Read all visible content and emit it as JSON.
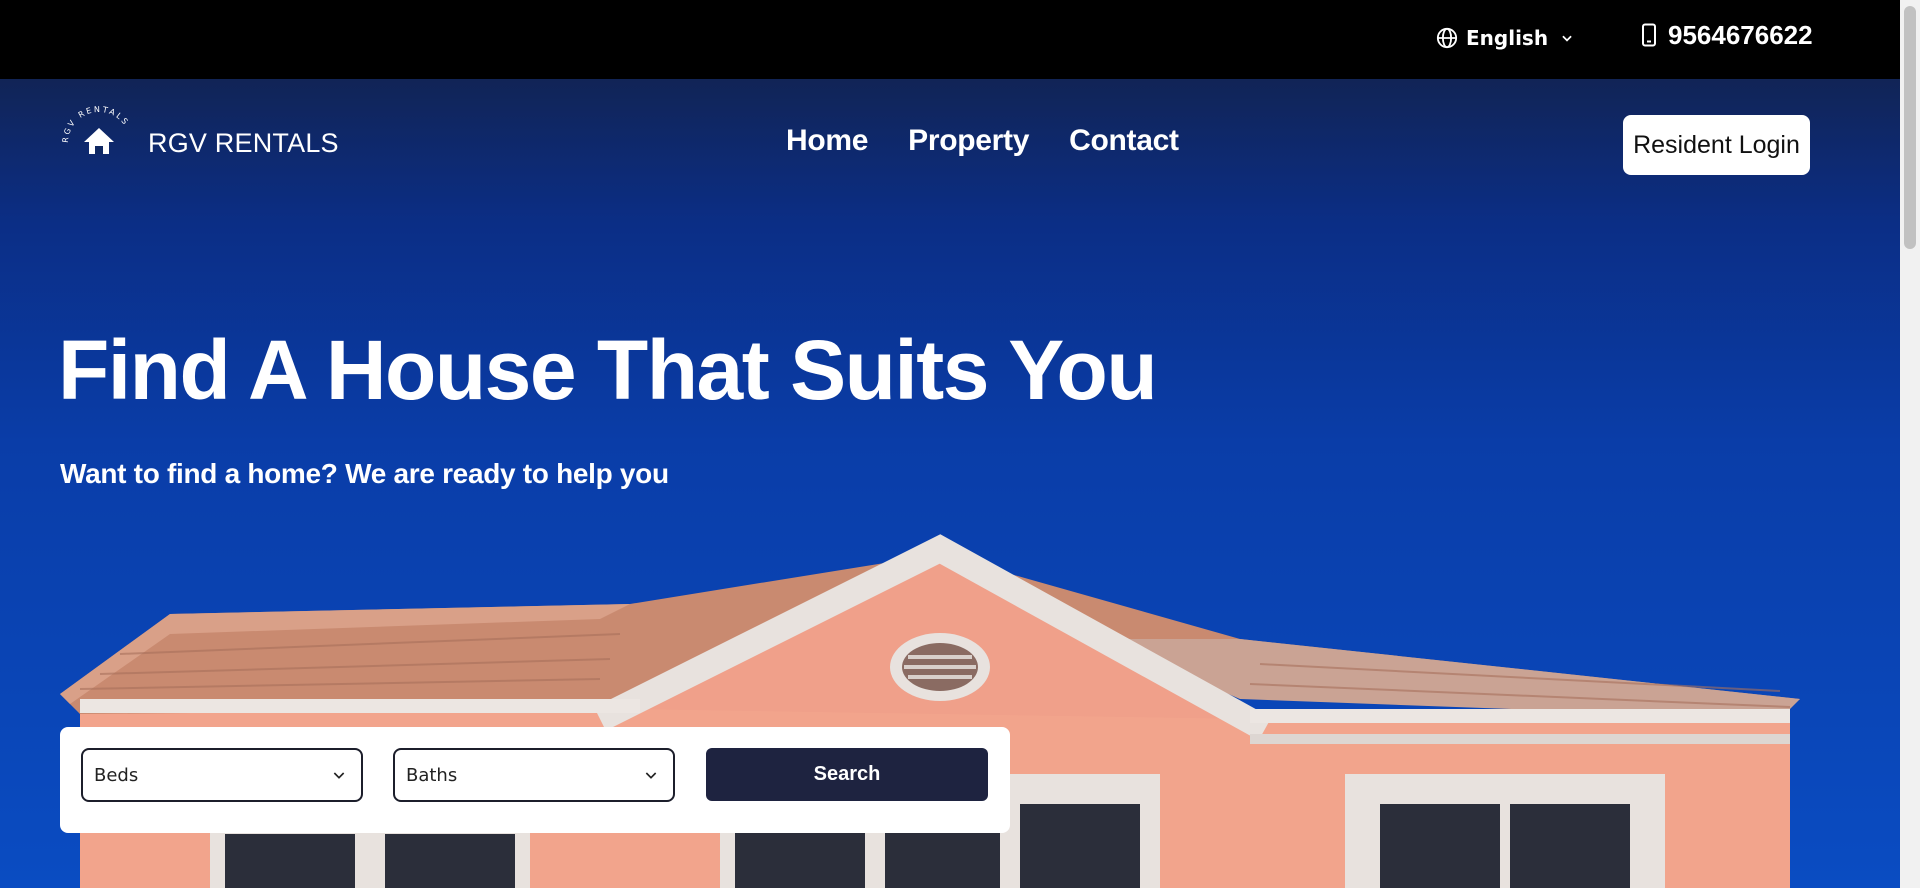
{
  "topbar": {
    "language": "English",
    "phone": "9564676622"
  },
  "header": {
    "logo_text": "RGV RENTALS",
    "logo_ring_text": "RGV RENTALS",
    "nav": [
      {
        "label": "Home"
      },
      {
        "label": "Property"
      },
      {
        "label": "Contact"
      }
    ],
    "login_label": "Resident Login"
  },
  "hero": {
    "title": "Find A House That Suits You",
    "subtitle": "Want to find a home? We are ready to help you"
  },
  "search": {
    "beds_label": "Beds",
    "baths_label": "Baths",
    "button_label": "Search"
  },
  "colors": {
    "topbar": "#000000",
    "search_button": "#1e2340",
    "hero_top": "#112456",
    "hero_bottom": "#0a4cc2",
    "wall": "#f2a48c"
  },
  "icons": {
    "language": "globe-icon",
    "phone": "mobile-phone-icon",
    "logo": "house-icon",
    "dropdown": "chevron-down-icon"
  }
}
